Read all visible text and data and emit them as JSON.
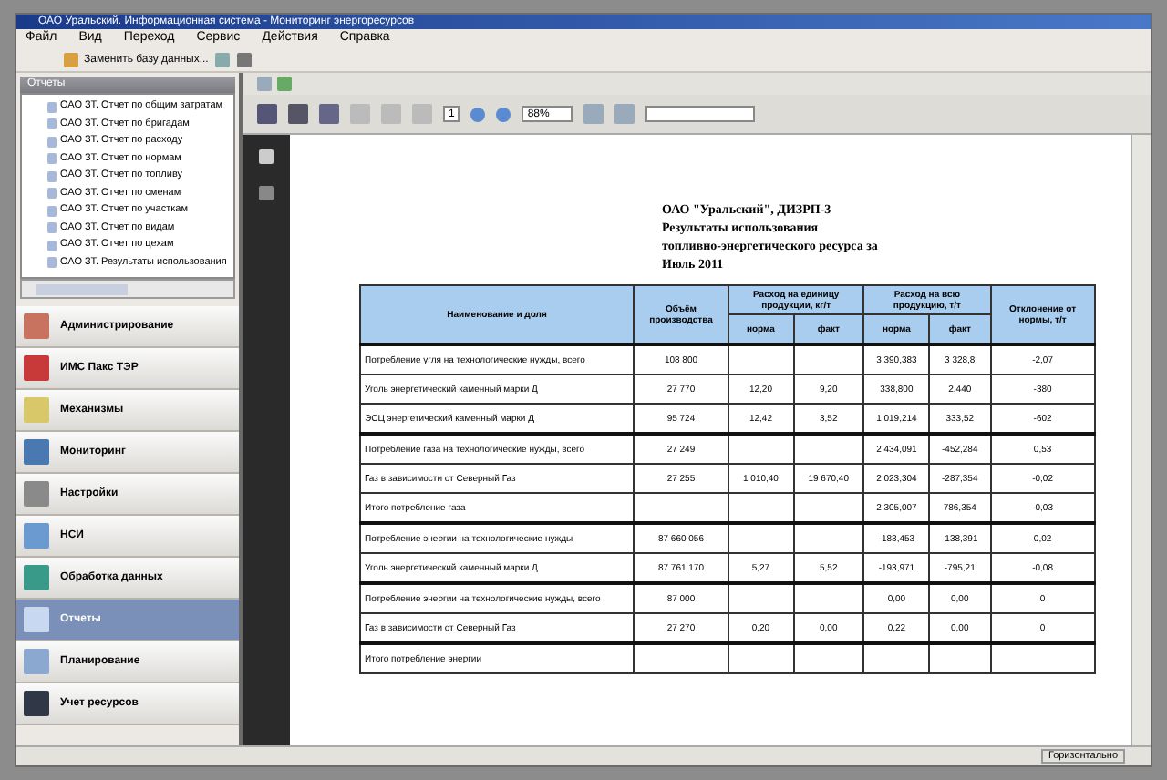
{
  "window": {
    "title": "ОАО Уральский. Информационная система - Мониторинг энергоресурсов"
  },
  "menu": [
    "Файл",
    "Вид",
    "Переход",
    "Сервис",
    "Действия",
    "Справка"
  ],
  "toolbar": {
    "database": "Заменить базу данных..."
  },
  "left_panel": {
    "header": "Отчеты",
    "tree": [
      {
        "label": "ОАО ЗТ. Отчет по общим затратам",
        "selected": false
      },
      {
        "label": "ОАО ЗТ. Отчет по бригадам",
        "selected": false
      },
      {
        "label": "ОАО ЗТ. Отчет по расходу",
        "selected": false
      },
      {
        "label": "ОАО ЗТ. Отчет по нормам",
        "selected": false
      },
      {
        "label": "ОАО ЗТ. Отчет по топливу",
        "selected": false
      },
      {
        "label": "ОАО ЗТ. Отчет по сменам",
        "selected": false
      },
      {
        "label": "ОАО ЗТ. Отчет по участкам",
        "selected": false
      },
      {
        "label": "ОАО ЗТ. Отчет по видам",
        "selected": false
      },
      {
        "label": "ОАО ЗТ. Отчет по цехам",
        "selected": false
      },
      {
        "label": "ОАО ЗТ. Результаты использования",
        "selected": false
      }
    ],
    "nav": [
      {
        "label": "Администрирование",
        "selected": false
      },
      {
        "label": "ИМС Пакс ТЭР",
        "selected": false
      },
      {
        "label": "Механизмы",
        "selected": false
      },
      {
        "label": "Мониторинг",
        "selected": false
      },
      {
        "label": "Настройки",
        "selected": false
      },
      {
        "label": "НСИ",
        "selected": false
      },
      {
        "label": "Обработка данных",
        "selected": false
      },
      {
        "label": "Отчеты",
        "selected": true
      },
      {
        "label": "Планирование",
        "selected": false
      },
      {
        "label": "Учет ресурсов",
        "selected": false
      }
    ]
  },
  "viewer": {
    "page": "1",
    "zoom": "88%"
  },
  "document": {
    "title_lines": [
      "ОАО \"Уральский\", ДИЗРП-3",
      "Результаты использования",
      "топливно-энергетического ресурса за",
      "Июль 2011"
    ],
    "table": {
      "header_rows": [
        [
          {
            "text": "Наименование и доля",
            "rowspan": 2
          },
          {
            "text": "Объём производства",
            "rowspan": 2
          },
          {
            "text": "Расход на единицу продукции, кг/т",
            "colspan": 2
          },
          {
            "text": "Расход на всю продукцию, т/т",
            "colspan": 2
          },
          {
            "text": "Отклонение от нормы, т/т",
            "rowspan": 2
          }
        ],
        [
          {
            "text": "норма"
          },
          {
            "text": "факт"
          },
          {
            "text": "норма"
          },
          {
            "text": "факт"
          }
        ]
      ],
      "rows": [
        {
          "kind": "group",
          "cells": [
            "Потребление угля на технологические нужды, всего",
            "108 800",
            "",
            "",
            "3 390,383",
            "3 328,8",
            "-2,07"
          ]
        },
        {
          "kind": "item",
          "cells": [
            "Уголь энергетический каменный марки Д",
            "27 770",
            "12,20",
            "9,20",
            "338,800",
            "2,440",
            "-380"
          ]
        },
        {
          "kind": "item",
          "cells": [
            "ЭСЦ энергетический каменный марки Д",
            "95 724",
            "12,42",
            "3,52",
            "1 019,214",
            "333,52",
            "-602"
          ]
        },
        {
          "kind": "group",
          "cells": [
            "Потребление газа на технологические нужды, всего",
            "27 249",
            "",
            "",
            "2 434,091",
            "-452,284",
            "0,53"
          ]
        },
        {
          "kind": "item",
          "cells": [
            "Газ в зависимости от Северный Газ",
            "27 255",
            "1 010,40",
            "19 670,40",
            "2 023,304",
            "-287,354",
            "-0,02"
          ]
        },
        {
          "kind": "item",
          "cells": [
            "Итого потребление газа",
            "",
            "",
            "",
            "2 305,007",
            "786,354",
            "-0,03"
          ]
        },
        {
          "kind": "group",
          "cells": [
            "Потребление энергии на технологические нужды",
            "87 660 056",
            "",
            "",
            "-183,453",
            "-138,391",
            "0,02"
          ]
        },
        {
          "kind": "item",
          "cells": [
            "Уголь энергетический каменный марки Д",
            "87 761 170",
            "5,27",
            "5,52",
            "-193,971",
            "-795,21",
            "-0,08"
          ]
        },
        {
          "kind": "group",
          "cells": [
            "Потребление энергии на технологические нужды, всего",
            "87 000",
            "",
            "",
            "0,00",
            "0,00",
            "0"
          ]
        },
        {
          "kind": "item",
          "cells": [
            "Газ в зависимости от Северный Газ",
            "27 270",
            "0,20",
            "0,00",
            "0,22",
            "0,00",
            "0"
          ]
        },
        {
          "kind": "group",
          "cells": [
            "Итого потребление энергии",
            "",
            "",
            "",
            "",
            "",
            ""
          ]
        }
      ]
    }
  },
  "status_bar": {
    "text": "Горизонтально"
  }
}
